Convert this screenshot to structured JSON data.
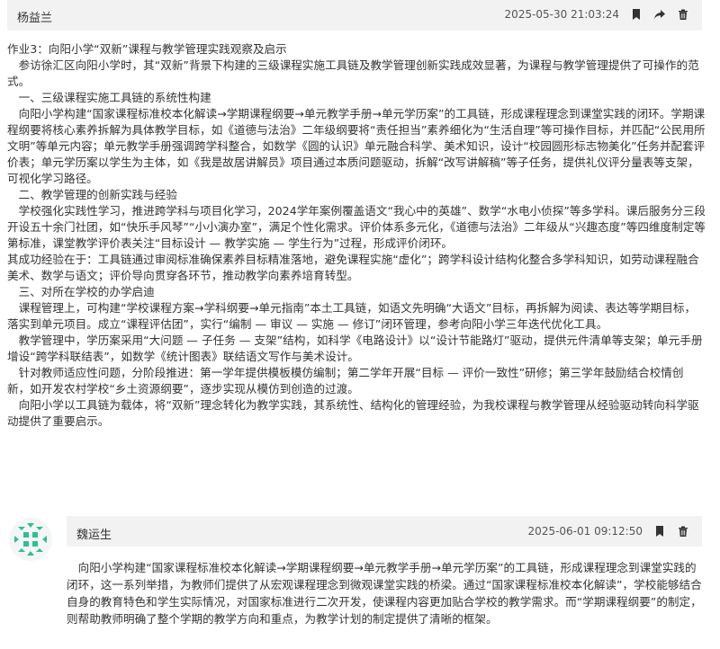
{
  "post": {
    "author": "杨益兰",
    "timestamp": "2025-05-30 21:03:24",
    "icons": [
      "bookmark-icon",
      "share-icon",
      "trash-icon"
    ],
    "paragraphs": [
      "作业3：向阳小学“双新”课程与教学管理实践观察及启示",
      "　参访徐汇区向阳小学时，其“双新”背景下构建的三级课程实施工具链及教学管理创新实践成效显著，为课程与教学管理提供了可操作的范式。",
      "　一、三级课程实施工具链的系统性构建",
      "　向阳小学构建“国家课程标准校本化解读→学期课程纲要→单元教学手册→单元学历案”的工具链，形成课程理念到课堂实践的闭环。学期课程纲要将核心素养拆解为具体教学目标，如《道德与法治》二年级纲要将“责任担当”素养细化为“生活自理”等可操作目标，并匹配“公民用所文明”等单元内容；单元教学手册强调跨学科整合，如数学《圆的认识》单元融合科学、美术知识，设计“校园圆形标志物美化”任务并配套评价表；单元学历案以学生为主体，如《我是故居讲解员》项目通过本质问题驱动，拆解“改写讲解稿”等子任务，提供礼仪评分量表等支架，可视化学习路径。",
      "　二、教学管理的创新实践与经验",
      "　学校强化实践性学习，推进跨学科与项目化学习，2024学年案例覆盖语文“我心中的英雄”、数学“水电小侦探”等多学科。课后服务分三段开设五十余门社团，如“快乐手风琴”“小小演办室”，满足个性化需求。评价体系多元化，《道德与法治》二年级从“兴趣态度”等四维度制定等第标准，课堂教学评价表关注“目标设计 — 教学实施 — 学生行为”过程，形成评价闭环。",
      "其成功经验在于：工具链通过审阅标准确保素养目标精准落地，避免课程实施“虚化”；跨学科设计结构化整合多学科知识，如劳动课程融合美术、数学与语文；评价导向贯穿各环节，推动教学向素养培育转型。",
      "　三、对所在学校的办学启迪",
      "　课程管理上，可构建“学校课程方案→学科纲要→单元指南”本土工具链，如语文先明确“大语文”目标，再拆解为阅读、表达等学期目标，落实到单元项目。成立“课程评估团”，实行“编制 — 审议 — 实施 — 修订”闭环管理，参考向阳小学三年迭代优化工具。",
      "　教学管理中，学历案采用“大问题 — 子任务 — 支架”结构，如科学《电路设计》以“设计节能路灯”驱动，提供元件清单等支架；单元手册增设“跨学科联结表”，如数学《统计图表》联结语文写作与美术设计。",
      "　针对教师适应性问题，分阶段推进：第一学年提供模板模仿编制；第二学年开展“目标 — 评价一致性”研修；第三学年鼓励结合校情创新，如开发农村学校“乡土资源纲要”，逐步实现从模仿到创造的过渡。",
      "　向阳小学以工具链为载体，将“双新”理念转化为教学实践，其系统性、结构化的管理经验，为我校课程与教学管理从经验驱动转向科学驱动提供了重要启示。"
    ]
  },
  "reply": {
    "author": "魏运生",
    "timestamp": "2025-06-01 09:12:50",
    "avatar_color": "#2fbf8f",
    "icons": [
      "bookmark-icon",
      "trash-icon"
    ],
    "text": "　向阳小学构建“国家课程标准校本化解读→学期课程纲要→单元教学手册→单元学历案”的工具链，形成课程理念到课堂实践的闭环，这一系列举措，为教师们提供了从宏观课程理念到微观课堂实践的桥梁。通过“国家课程标准校本化解读”，学校能够结合自身的教育特色和学生实际情况，对国家标准进行二次开发，使课程内容更加贴合学校的教学需求。而“学期课程纲要”的制定，则帮助教师明确了整个学期的教学方向和重点，为教学计划的制定提供了清晰的框架。"
  }
}
